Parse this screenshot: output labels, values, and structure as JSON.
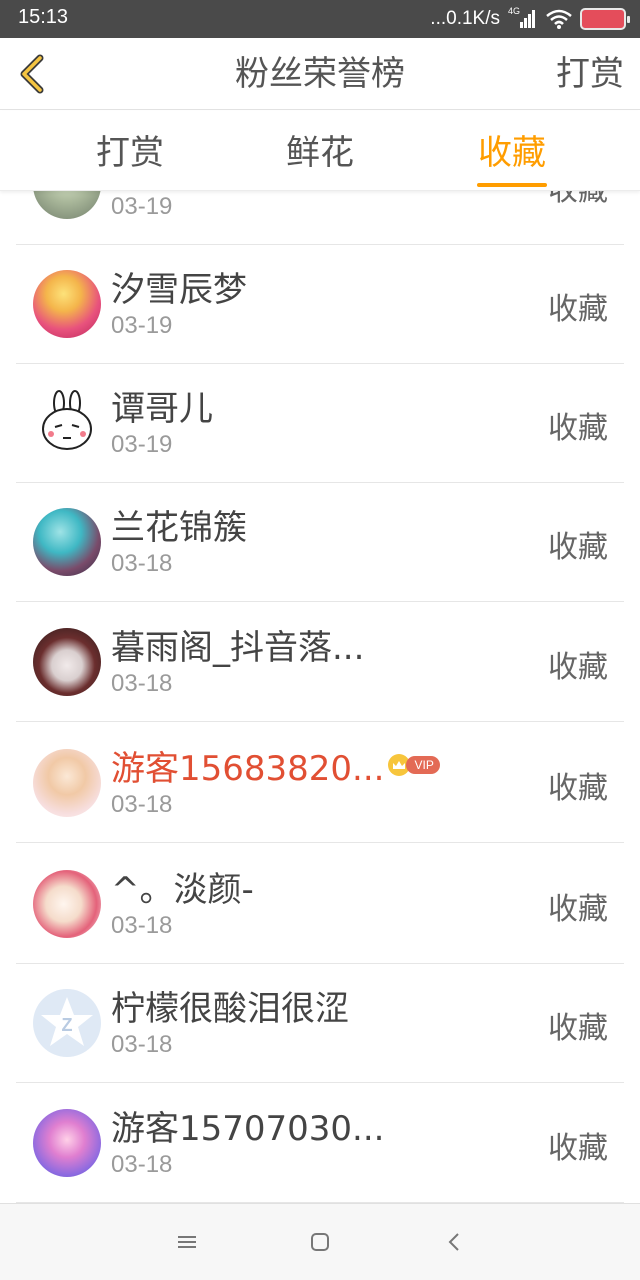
{
  "status_bar": {
    "time": "15:13",
    "network_speed": "...0.1K/s",
    "network_type": "4G",
    "icons": [
      "signal-icon",
      "wifi-icon",
      "battery-icon"
    ]
  },
  "header": {
    "title": "粉丝荣誉榜",
    "back_icon": "chevron-left-icon",
    "action_label": "打赏"
  },
  "tabs": [
    {
      "label": "打赏",
      "active": false
    },
    {
      "label": "鲜花",
      "active": false
    },
    {
      "label": "收藏",
      "active": true
    }
  ],
  "accent_color": "#ff9d00",
  "vip_name_color": "#e14f33",
  "list": [
    {
      "name": "",
      "date": "03-19",
      "action": "收藏",
      "vip": false
    },
    {
      "name": "汐雪辰梦",
      "date": "03-19",
      "action": "收藏",
      "vip": false
    },
    {
      "name": "谭哥儿",
      "date": "03-19",
      "action": "收藏",
      "vip": false
    },
    {
      "name": "兰花锦簇",
      "date": "03-18",
      "action": "收藏",
      "vip": false
    },
    {
      "name": "暮雨阁_抖音落...",
      "date": "03-18",
      "action": "收藏",
      "vip": false
    },
    {
      "name": "游客15683820...",
      "date": "03-18",
      "action": "收藏",
      "vip": true,
      "badge": "VIP"
    },
    {
      "name": "^。淡颜-",
      "date": "03-18",
      "action": "收藏",
      "vip": false
    },
    {
      "name": "柠檬很酸泪很涩",
      "date": "03-18",
      "action": "收藏",
      "vip": false
    },
    {
      "name": "游客15707030...",
      "date": "03-18",
      "action": "收藏",
      "vip": false
    }
  ],
  "system_nav": [
    "menu-icon",
    "home-icon",
    "back-icon"
  ]
}
